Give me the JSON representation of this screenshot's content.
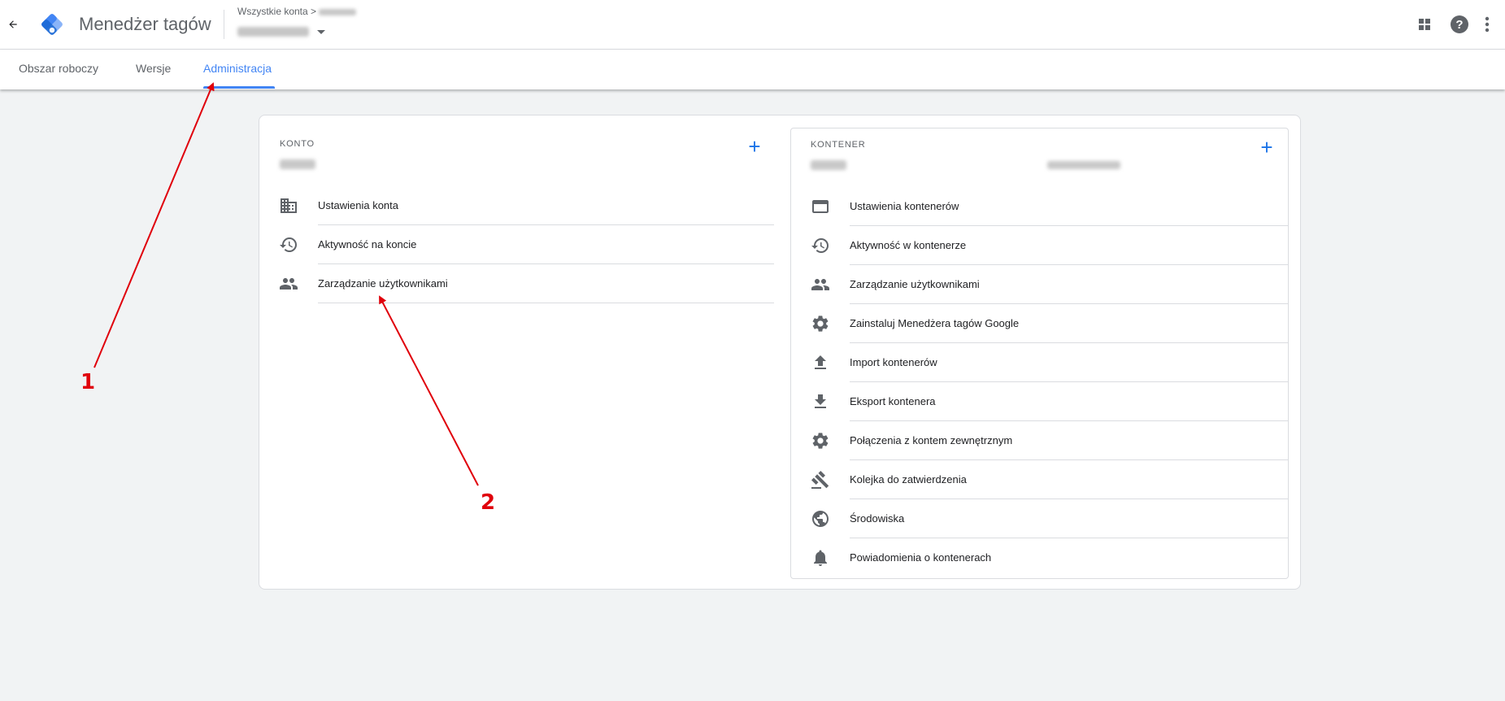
{
  "header": {
    "back_icon": "arrow-back-icon",
    "app_title": "Menedżer tagów",
    "breadcrumb_root": "Wszystkie konta",
    "breadcrumb_sep": ">",
    "apps_icon": "apps-grid-icon",
    "help_icon": "help-icon",
    "more_icon": "more-vert-icon",
    "logo_colors": [
      "#8ab4f8",
      "#4285f4",
      "#1967d2"
    ]
  },
  "tabs": [
    {
      "label": "Obszar roboczy",
      "active": false
    },
    {
      "label": "Wersje",
      "active": false
    },
    {
      "label": "Administracja",
      "active": true
    }
  ],
  "account": {
    "section_label": "KONTO",
    "items": [
      {
        "label": "Ustawienia konta",
        "icon": "building-icon"
      },
      {
        "label": "Aktywność na koncie",
        "icon": "history-icon"
      },
      {
        "label": "Zarządzanie użytkownikami",
        "icon": "people-icon"
      }
    ]
  },
  "container": {
    "section_label": "KONTENER",
    "items": [
      {
        "label": "Ustawienia kontenerów",
        "icon": "web-window-icon"
      },
      {
        "label": "Aktywność w kontenerze",
        "icon": "history-icon"
      },
      {
        "label": "Zarządzanie użytkownikami",
        "icon": "people-icon"
      },
      {
        "label": "Zainstaluj Menedżera tagów Google",
        "icon": "gear-icon"
      },
      {
        "label": "Import kontenerów",
        "icon": "upload-icon"
      },
      {
        "label": "Eksport kontenera",
        "icon": "download-icon"
      },
      {
        "label": "Połączenia z kontem zewnętrznym",
        "icon": "gear-icon"
      },
      {
        "label": "Kolejka do zatwierdzenia",
        "icon": "gavel-icon"
      },
      {
        "label": "Środowiska",
        "icon": "globe-icon"
      },
      {
        "label": "Powiadomienia o kontenerach",
        "icon": "bell-icon"
      }
    ]
  },
  "annotations": {
    "label_1": "1",
    "label_2": "2",
    "color": "#e0000b"
  }
}
